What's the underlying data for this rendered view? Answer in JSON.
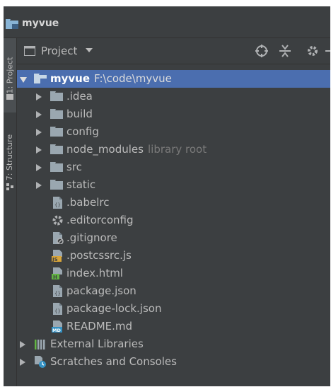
{
  "window": {
    "title": "myvue"
  },
  "left_strip": {
    "tabs": [
      {
        "label": "1: Project"
      },
      {
        "label": "7: Structure"
      }
    ]
  },
  "toolbar": {
    "view_label": "Project"
  },
  "tree": {
    "root": {
      "name": "myvue",
      "path": "F:\\code\\myvue"
    },
    "items": [
      {
        "name": ".idea"
      },
      {
        "name": "build"
      },
      {
        "name": "config"
      },
      {
        "name": "node_modules",
        "hint": "library root"
      },
      {
        "name": "src"
      },
      {
        "name": "static"
      },
      {
        "name": ".babelrc"
      },
      {
        "name": ".editorconfig"
      },
      {
        "name": ".gitignore"
      },
      {
        "name": ".postcssrc.js"
      },
      {
        "name": "index.html"
      },
      {
        "name": "package.json"
      },
      {
        "name": "package-lock.json"
      },
      {
        "name": "README.md"
      }
    ],
    "bottom": [
      {
        "name": "External Libraries"
      },
      {
        "name": "Scratches and Consoles"
      }
    ]
  }
}
